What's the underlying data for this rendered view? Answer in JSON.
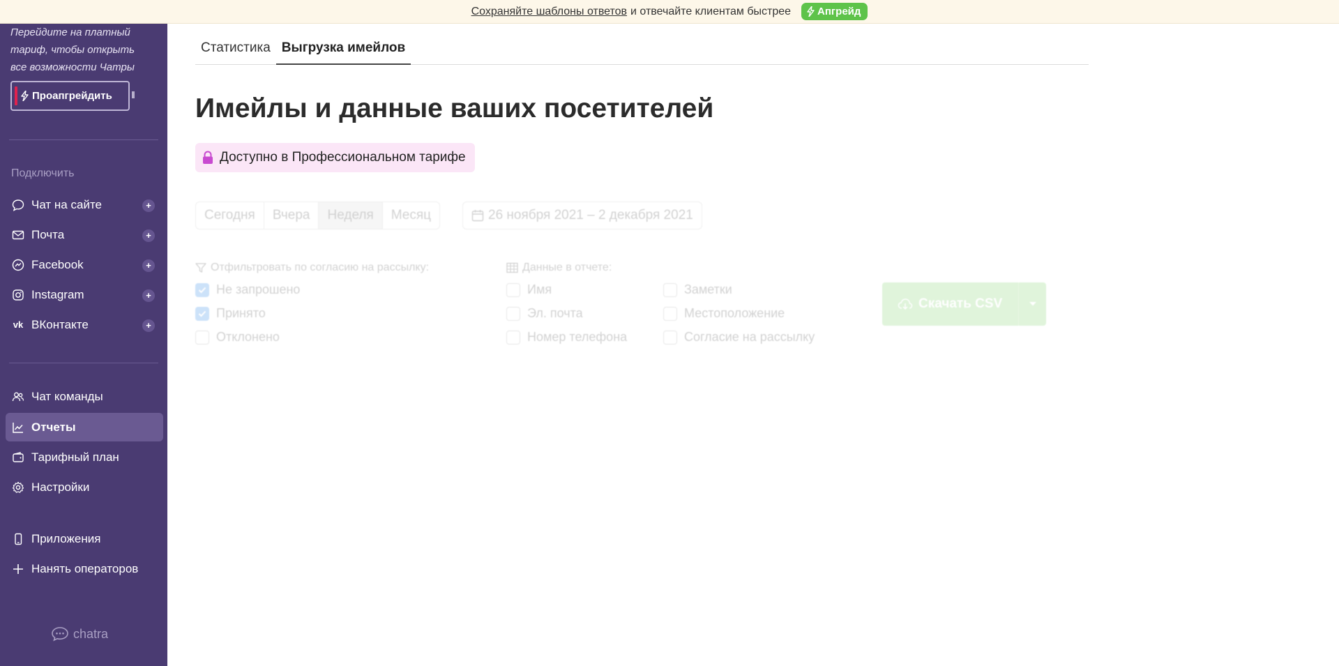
{
  "banner": {
    "link_text": "Сохраняйте шаблоны ответов",
    "rest_text": "и отвечайте клиентам быстрее",
    "button_label": "Апгрейд"
  },
  "sidebar": {
    "promo_text": "Перейдите на платный тариф, чтобы открыть все возможности Чатры",
    "upgrade_label": "Проапгрейдить",
    "connect_label": "Подключить",
    "connect_items": [
      {
        "label": "Чат на сайте",
        "icon": "chat-bubble-icon"
      },
      {
        "label": "Почта",
        "icon": "mail-icon"
      },
      {
        "label": "Facebook",
        "icon": "messenger-icon"
      },
      {
        "label": "Instagram",
        "icon": "instagram-icon"
      },
      {
        "label": "ВКонтакте",
        "icon": "vk-icon"
      }
    ],
    "main_items": [
      {
        "label": "Чат команды",
        "icon": "team-icon"
      },
      {
        "label": "Отчеты",
        "icon": "chart-icon",
        "active": true
      },
      {
        "label": "Тарифный план",
        "icon": "wallet-icon"
      },
      {
        "label": "Настройки",
        "icon": "gear-icon"
      }
    ],
    "extra_items": [
      {
        "label": "Приложения",
        "icon": "phone-icon"
      },
      {
        "label": "Нанять операторов",
        "icon": "plus-icon"
      }
    ],
    "brand": "chatra"
  },
  "tabs": [
    {
      "label": "Статистика",
      "active": false
    },
    {
      "label": "Выгрузка имейлов",
      "active": true
    }
  ],
  "page_title": "Имейлы и данные ваших посетителей",
  "pro_badge": "Доступно в Профессиональном тарифе",
  "period": {
    "options": [
      "Сегодня",
      "Вчера",
      "Неделя",
      "Месяц"
    ],
    "selected": "Неделя",
    "date_range": "26 ноября 2021 – 2 декабря 2021"
  },
  "filter": {
    "label": "Отфильтровать по согласию на рассылку:",
    "options": [
      {
        "label": "Не запрошено",
        "checked": true
      },
      {
        "label": "Принято",
        "checked": true
      },
      {
        "label": "Отклонено",
        "checked": false
      }
    ]
  },
  "report_data": {
    "label": "Данные в отчете:",
    "col1": [
      {
        "label": "Имя",
        "checked": false
      },
      {
        "label": "Эл. почта",
        "checked": false
      },
      {
        "label": "Номер телефона",
        "checked": false
      }
    ],
    "col2": [
      {
        "label": "Заметки",
        "checked": false
      },
      {
        "label": "Местоположение",
        "checked": false
      },
      {
        "label": "Согласие на рассылку",
        "checked": false
      }
    ]
  },
  "download": {
    "label": "Скачать CSV"
  }
}
